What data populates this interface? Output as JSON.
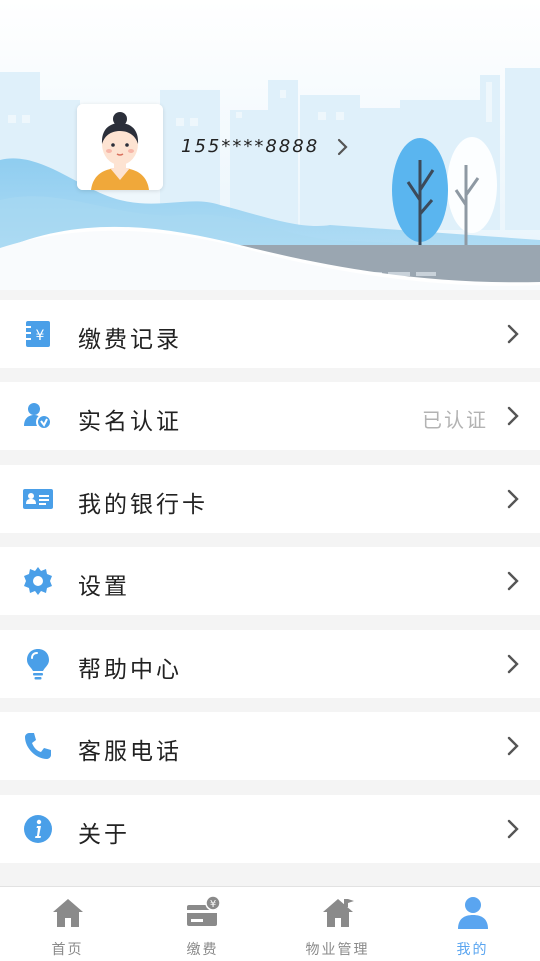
{
  "profile": {
    "phone": "155****8888"
  },
  "menu": [
    {
      "label": "缴费记录",
      "icon": "bill-receipt-icon",
      "status": ""
    },
    {
      "label": "实名认证",
      "icon": "verified-user-icon",
      "status": "已认证"
    },
    {
      "label": "我的银行卡",
      "icon": "bank-card-icon",
      "status": ""
    },
    {
      "label": "设置",
      "icon": "gear-icon",
      "status": ""
    },
    {
      "label": "帮助中心",
      "icon": "lightbulb-icon",
      "status": ""
    },
    {
      "label": "客服电话",
      "icon": "phone-icon",
      "status": ""
    },
    {
      "label": "关于",
      "icon": "info-icon",
      "status": ""
    }
  ],
  "tabs": [
    {
      "label": "首页",
      "icon": "home-icon",
      "active": false
    },
    {
      "label": "缴费",
      "icon": "payment-card-icon",
      "active": false
    },
    {
      "label": "物业管理",
      "icon": "property-house-icon",
      "active": false
    },
    {
      "label": "我的",
      "icon": "person-icon",
      "active": true
    }
  ],
  "colors": {
    "accent": "#5aa5f0",
    "icon_blue": "#4a9fe8",
    "inactive_tab": "#8a8a8a",
    "header_sky": "#cfe7f7"
  }
}
